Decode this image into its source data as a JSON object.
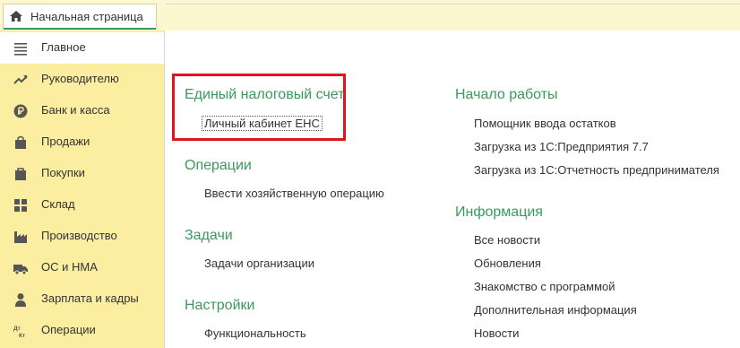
{
  "tab": {
    "label": "Начальная страница",
    "icon": "home-icon"
  },
  "sidebar": {
    "items": [
      {
        "label": "Главное",
        "icon": "menu-lines-icon",
        "active": true
      },
      {
        "label": "Руководителю",
        "icon": "trend-up-icon"
      },
      {
        "label": "Банк и касса",
        "icon": "ruble-coin-icon"
      },
      {
        "label": "Продажи",
        "icon": "shopping-bag-icon"
      },
      {
        "label": "Покупки",
        "icon": "shopping-cart-icon"
      },
      {
        "label": "Склад",
        "icon": "warehouse-grid-icon"
      },
      {
        "label": "Производство",
        "icon": "factory-icon"
      },
      {
        "label": "ОС и НМА",
        "icon": "truck-icon"
      },
      {
        "label": "Зарплата и кадры",
        "icon": "person-icon"
      },
      {
        "label": "Операции",
        "icon": "dt-kt-icon"
      }
    ]
  },
  "left_column": {
    "sections": [
      {
        "title": "Единый налоговый счет",
        "links": [
          "Личный кабинет ЕНС"
        ]
      },
      {
        "title": "Операции",
        "links": [
          "Ввести хозяйственную операцию"
        ]
      },
      {
        "title": "Задачи",
        "links": [
          "Задачи организации"
        ]
      },
      {
        "title": "Настройки",
        "links": [
          "Функциональность"
        ]
      }
    ]
  },
  "right_column": {
    "sections": [
      {
        "title": "Начало работы",
        "links": [
          "Помощник ввода остатков",
          "Загрузка из 1С:Предприятия 7.7",
          "Загрузка из 1С:Отчетность предпринимателя"
        ]
      },
      {
        "title": "Информация",
        "links": [
          "Все новости",
          "Обновления",
          "Знакомство с программой",
          "Дополнительная информация",
          "Новости"
        ]
      }
    ]
  },
  "colors": {
    "accent": "#3a9a5b",
    "sidebar_bg": "#fbeea0",
    "highlight": "#e0141a"
  }
}
